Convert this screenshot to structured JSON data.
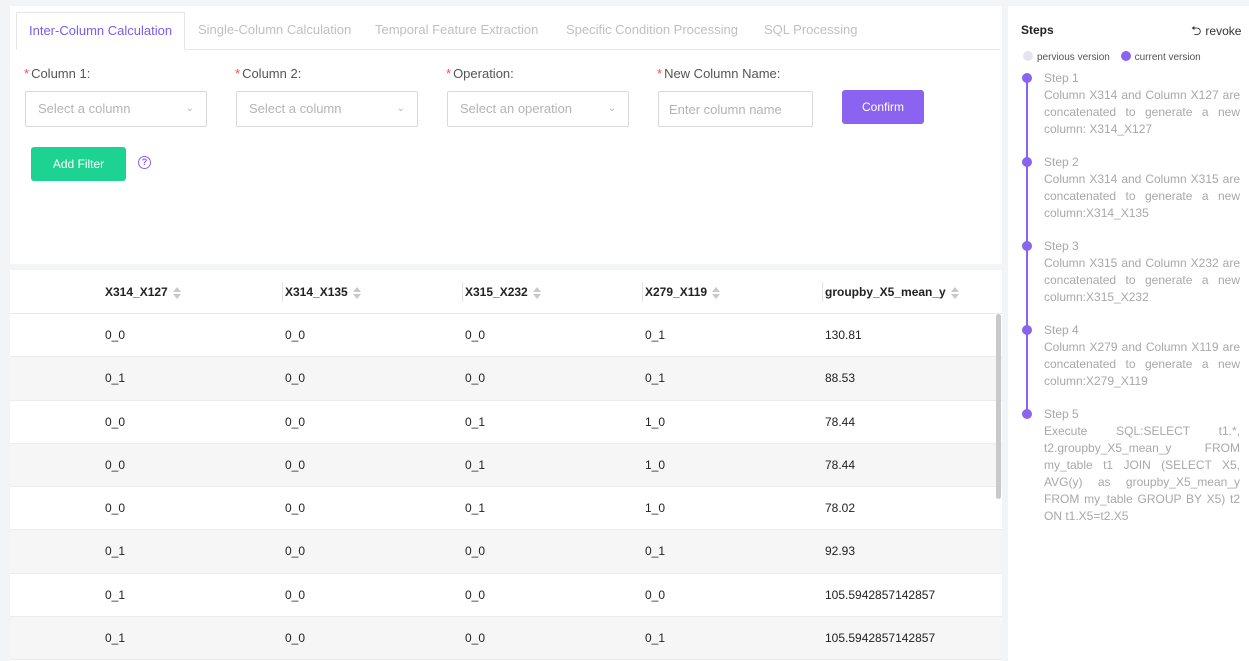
{
  "tabs": [
    {
      "label": "Inter-Column Calculation",
      "active": true
    },
    {
      "label": "Single-Column Calculation",
      "active": false
    },
    {
      "label": "Temporal Feature Extraction",
      "active": false
    },
    {
      "label": "Specific Condition Processing",
      "active": false
    },
    {
      "label": "SQL Processing",
      "active": false
    }
  ],
  "form": {
    "required_mark": "*",
    "column1_label": "Column 1:",
    "column1_placeholder": "Select a column",
    "column2_label": "Column 2:",
    "column2_placeholder": "Select a column",
    "operation_label": "Operation:",
    "operation_placeholder": "Select an operation",
    "new_column_label": "New Column Name:",
    "new_column_placeholder": "Enter column name",
    "confirm_label": "Confirm",
    "add_filter_label": "Add Filter",
    "help_glyph": "?"
  },
  "table": {
    "columns": [
      "X314_X127",
      "X314_X135",
      "X315_X232",
      "X279_X119",
      "groupby_X5_mean_y"
    ],
    "rows": [
      [
        "0_0",
        "0_0",
        "0_0",
        "0_1",
        "130.81"
      ],
      [
        "0_1",
        "0_0",
        "0_0",
        "0_1",
        "88.53"
      ],
      [
        "0_0",
        "0_0",
        "0_1",
        "1_0",
        "78.44"
      ],
      [
        "0_0",
        "0_0",
        "0_1",
        "1_0",
        "78.44"
      ],
      [
        "0_0",
        "0_0",
        "0_1",
        "1_0",
        "78.02"
      ],
      [
        "0_1",
        "0_0",
        "0_0",
        "0_1",
        "92.93"
      ],
      [
        "0_1",
        "0_0",
        "0_0",
        "0_0",
        "105.5942857142857"
      ],
      [
        "0_1",
        "0_0",
        "0_0",
        "0_1",
        "105.5942857142857"
      ]
    ]
  },
  "steps_panel": {
    "title": "Steps",
    "revoke_label": "revoke",
    "revoke_glyph": "⮌",
    "legend_previous": "pervious version",
    "legend_current": "current version",
    "steps": [
      {
        "title": "Step 1",
        "text": "Column X314 and Column X127 are concatenated to generate a new column: X314_X127"
      },
      {
        "title": "Step 2",
        "text": "Column X314 and Column X315 are concatenated to generate a new column:X314_X135"
      },
      {
        "title": "Step 3",
        "text": "Column X315 and Column X232 are concatenated to generate a new column:X315_X232"
      },
      {
        "title": "Step 4",
        "text": "Column X279 and Column X119 are concatenated to generate a new column:X279_X119"
      },
      {
        "title": "Step 5",
        "text": "Execute SQL:SELECT t1.*, t2.groupby_X5_mean_y FROM my_table t1 JOIN (SELECT X5, AVG(y) as groupby_X5_mean_y FROM my_table GROUP BY X5) t2 ON t1.X5=t2.X5"
      }
    ]
  },
  "colors": {
    "accent": "#8a63f0",
    "add_filter": "#1dd392",
    "required": "#ff4d4f"
  }
}
